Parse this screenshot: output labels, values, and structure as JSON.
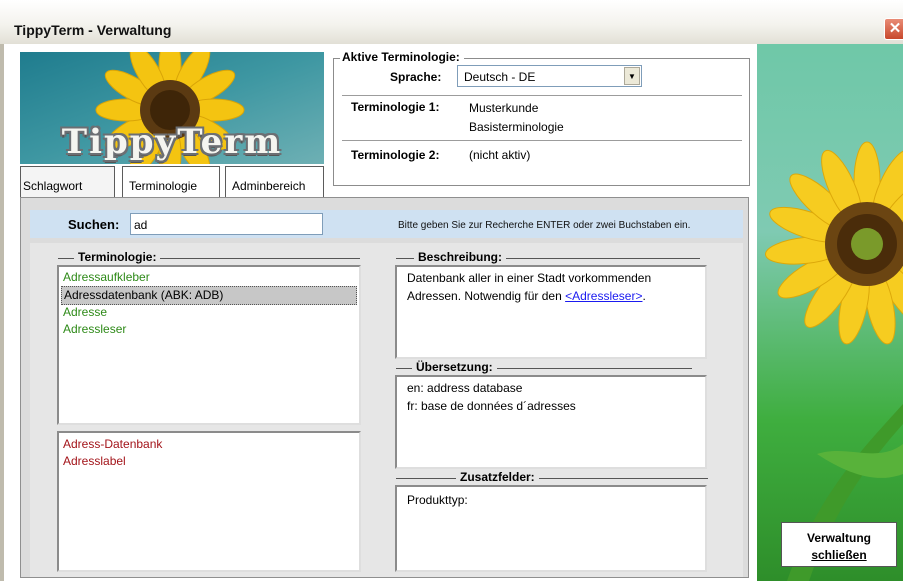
{
  "window": {
    "title": "TippyTerm - Verwaltung",
    "close_glyph": "✕"
  },
  "logo": {
    "text": "TippyTerm"
  },
  "tabs": [
    {
      "label": "Schlagwort"
    },
    {
      "label": "Terminologie"
    },
    {
      "label": "Adminbereich"
    }
  ],
  "aktive": {
    "legend": "Aktive Terminologie:",
    "sprache_label": "Sprache:",
    "sprache_value": "Deutsch - DE",
    "term1_label": "Terminologie 1:",
    "term1_line1": "Musterkunde",
    "term1_line2": "Basisterminologie",
    "term2_label": "Terminologie 2:",
    "term2_value": "(nicht aktiv)"
  },
  "search": {
    "label": "Suchen:",
    "value": "ad",
    "hint": "Bitte geben Sie zur Recherche ENTER oder zwei Buchstaben ein."
  },
  "terminologie": {
    "title": "Terminologie:",
    "items": [
      "Adressaufkleber",
      "Adressdatenbank (ABK: ADB)",
      "Adresse",
      "Adressleser"
    ],
    "selected_index": 1,
    "synonyms": [
      "Adress-Datenbank",
      "Adresslabel"
    ]
  },
  "beschreibung": {
    "title": "Beschreibung:",
    "line1": "Datenbank aller in einer Stadt vorkommenden",
    "line2_prefix": "Adressen. Notwendig für den",
    "link": "<Adressleser>",
    "line2_suffix": "."
  },
  "uebersetzung": {
    "title": "Übersetzung:",
    "lines": [
      "en: address database",
      "fr: base de données d´adresses"
    ]
  },
  "zusatzfelder": {
    "title": "Zusatzfelder:",
    "lines": [
      "Produkttyp:"
    ]
  },
  "close_panel": {
    "line1": "Verwaltung",
    "line2": "schließen"
  },
  "colors": {
    "term_green": "#2e8a18",
    "synonym_red": "#a3141a",
    "search_bar": "#cfe1f2",
    "link": "#1a1af0"
  }
}
